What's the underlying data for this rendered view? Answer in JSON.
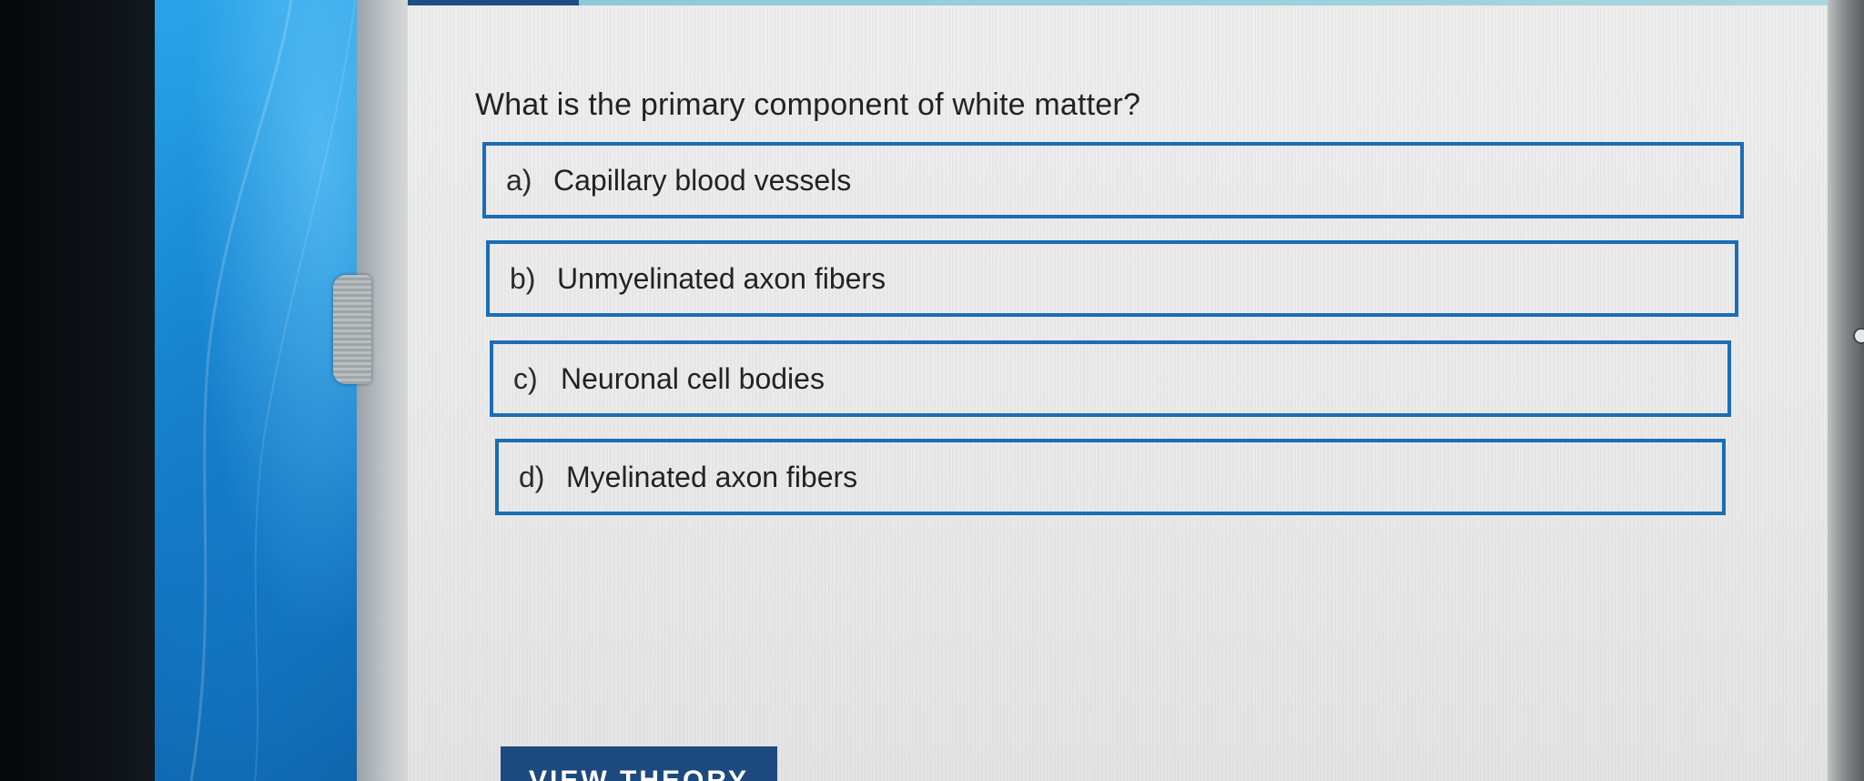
{
  "quiz": {
    "question": "What is the primary component of white matter?",
    "options": [
      {
        "letter": "a)",
        "text": "Capillary blood vessels"
      },
      {
        "letter": "b)",
        "text": "Unmyelinated axon fibers"
      },
      {
        "letter": "c)",
        "text": "Neuronal cell bodies"
      },
      {
        "letter": "d)",
        "text": "Myelinated axon fibers"
      }
    ],
    "view_theory_label": "VIEW THEORY"
  },
  "colors": {
    "option_border": "#1b6db5",
    "button_bg": "#1c4a7e",
    "wallpaper": "#1b8fd8"
  }
}
